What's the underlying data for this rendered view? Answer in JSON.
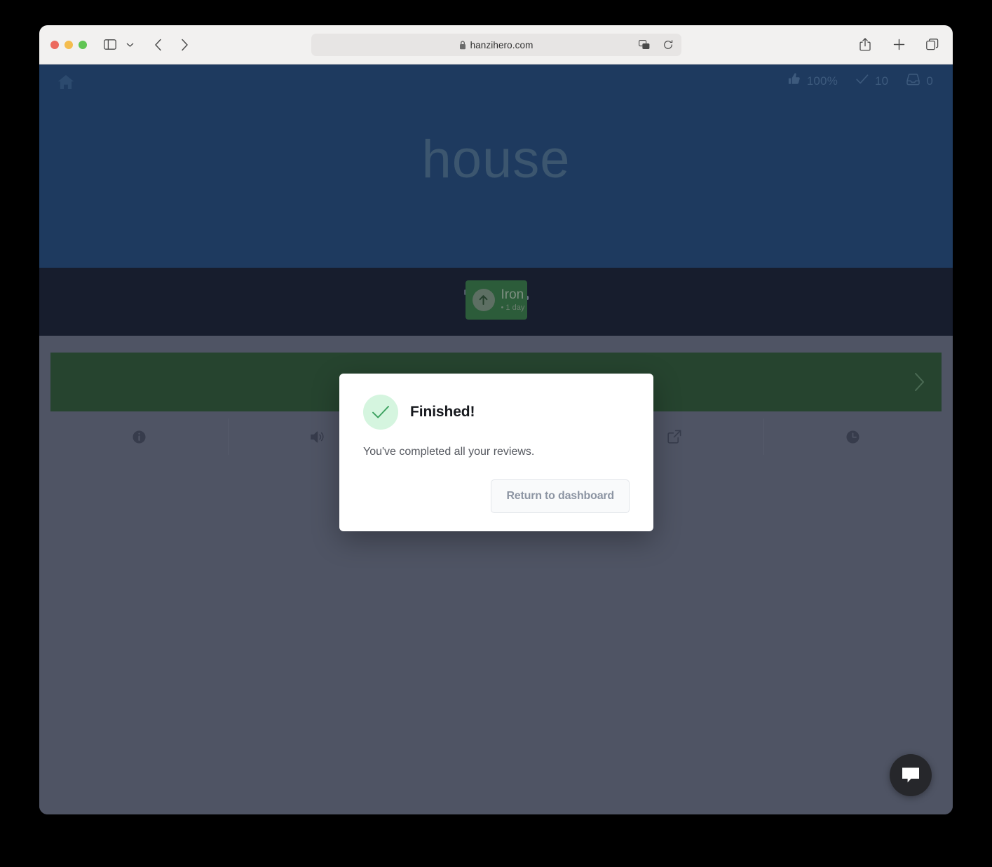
{
  "browser": {
    "url": "hanzihero.com",
    "secure_icon": "lock-icon",
    "traffic_lights": [
      "close",
      "minimize",
      "zoom"
    ],
    "sidebar_toggle_icon": "sidebar-icon",
    "sidebar_chevron_icon": "chevron-down-icon",
    "back_icon": "chevron-left-icon",
    "forward_icon": "chevron-right-icon",
    "translate_icon": "translate-icon",
    "reload_icon": "reload-icon",
    "share_icon": "share-icon",
    "new_tab_icon": "plus-icon",
    "tab_overview_icon": "tab-overview-icon"
  },
  "app": {
    "home_icon": "home-icon",
    "stats": [
      {
        "icon": "thumbs-up-icon",
        "value": "100%",
        "name": "accuracy"
      },
      {
        "icon": "check-icon",
        "value": "10",
        "name": "completed"
      },
      {
        "icon": "inbox-icon",
        "value": "0",
        "name": "remaining"
      }
    ],
    "prompt_word": "house",
    "level_badge": {
      "icon": "arrow-up-icon",
      "name": "Iron",
      "sub": "• 1 day"
    },
    "audio": {
      "speaker_icon": "speaker-icon",
      "placeholder_bars": 2
    },
    "answer": {
      "value": "",
      "placeholder": "",
      "submit_icon": "chevron-right-icon"
    },
    "tools": [
      {
        "icon": "info-icon",
        "name": "info"
      },
      {
        "icon": "speaker-icon",
        "name": "audio"
      },
      {
        "icon": "blank",
        "name": "spacer"
      },
      {
        "icon": "external-link-icon",
        "name": "open-external"
      },
      {
        "icon": "clock-icon",
        "name": "history"
      }
    ],
    "chat_icon": "chat-bubble-icon"
  },
  "modal": {
    "status_icon": "check-icon",
    "title": "Finished!",
    "body": "You've completed all your reviews.",
    "button_label": "Return to dashboard"
  },
  "colors": {
    "header_blue": "#1e3a5f",
    "midband": "#171d2d",
    "body_slate": "#4f5464",
    "answer_green": "#26442f",
    "badge_green": "#2c5c3a",
    "modal_check": "#3aa05e"
  }
}
